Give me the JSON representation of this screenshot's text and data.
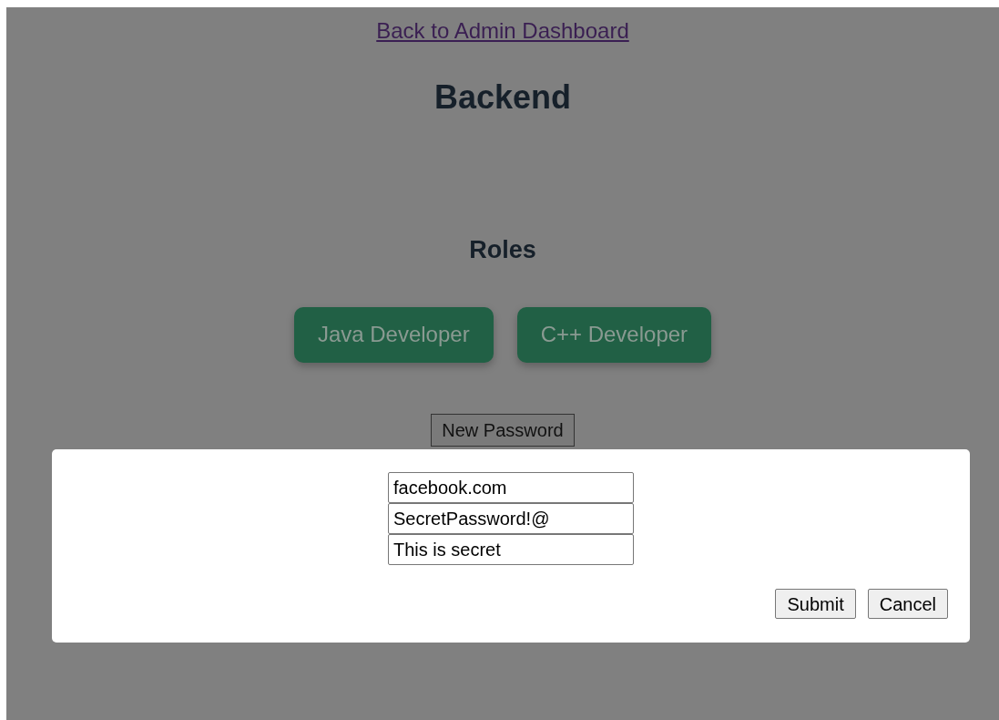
{
  "back_link": "Back to Admin Dashboard",
  "title": "Backend",
  "roles_heading": "Roles",
  "roles": [
    {
      "label": "Java Developer"
    },
    {
      "label": "C++ Developer"
    }
  ],
  "new_password_button": "New Password",
  "modal": {
    "fields": [
      {
        "value": "facebook.com"
      },
      {
        "value": "SecretPassword!@"
      },
      {
        "value": "This is secret"
      }
    ],
    "buttons": [
      "Submit",
      "Cancel"
    ]
  }
}
